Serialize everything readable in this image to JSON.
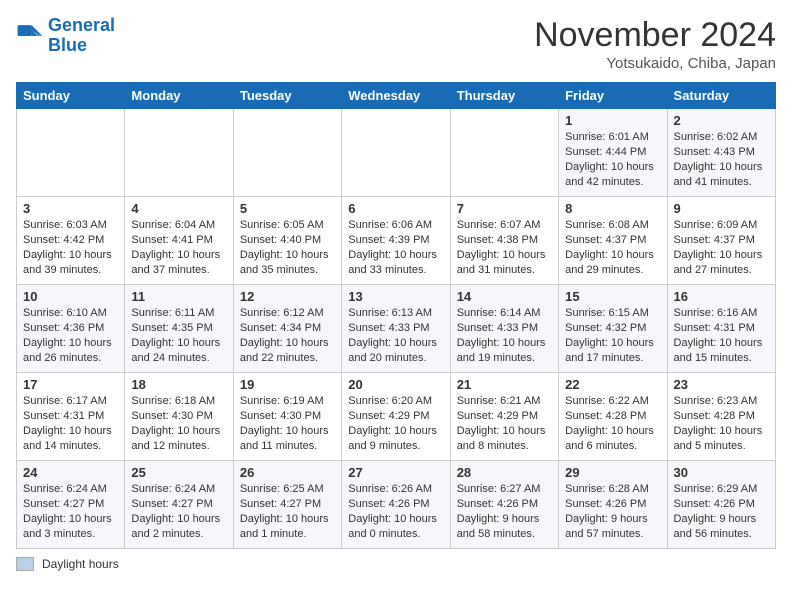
{
  "header": {
    "logo_line1": "General",
    "logo_line2": "Blue",
    "month": "November 2024",
    "location": "Yotsukaido, Chiba, Japan"
  },
  "weekdays": [
    "Sunday",
    "Monday",
    "Tuesday",
    "Wednesday",
    "Thursday",
    "Friday",
    "Saturday"
  ],
  "weeks": [
    [
      {
        "day": "",
        "info": ""
      },
      {
        "day": "",
        "info": ""
      },
      {
        "day": "",
        "info": ""
      },
      {
        "day": "",
        "info": ""
      },
      {
        "day": "",
        "info": ""
      },
      {
        "day": "1",
        "info": "Sunrise: 6:01 AM\nSunset: 4:44 PM\nDaylight: 10 hours and 42 minutes."
      },
      {
        "day": "2",
        "info": "Sunrise: 6:02 AM\nSunset: 4:43 PM\nDaylight: 10 hours and 41 minutes."
      }
    ],
    [
      {
        "day": "3",
        "info": "Sunrise: 6:03 AM\nSunset: 4:42 PM\nDaylight: 10 hours and 39 minutes."
      },
      {
        "day": "4",
        "info": "Sunrise: 6:04 AM\nSunset: 4:41 PM\nDaylight: 10 hours and 37 minutes."
      },
      {
        "day": "5",
        "info": "Sunrise: 6:05 AM\nSunset: 4:40 PM\nDaylight: 10 hours and 35 minutes."
      },
      {
        "day": "6",
        "info": "Sunrise: 6:06 AM\nSunset: 4:39 PM\nDaylight: 10 hours and 33 minutes."
      },
      {
        "day": "7",
        "info": "Sunrise: 6:07 AM\nSunset: 4:38 PM\nDaylight: 10 hours and 31 minutes."
      },
      {
        "day": "8",
        "info": "Sunrise: 6:08 AM\nSunset: 4:37 PM\nDaylight: 10 hours and 29 minutes."
      },
      {
        "day": "9",
        "info": "Sunrise: 6:09 AM\nSunset: 4:37 PM\nDaylight: 10 hours and 27 minutes."
      }
    ],
    [
      {
        "day": "10",
        "info": "Sunrise: 6:10 AM\nSunset: 4:36 PM\nDaylight: 10 hours and 26 minutes."
      },
      {
        "day": "11",
        "info": "Sunrise: 6:11 AM\nSunset: 4:35 PM\nDaylight: 10 hours and 24 minutes."
      },
      {
        "day": "12",
        "info": "Sunrise: 6:12 AM\nSunset: 4:34 PM\nDaylight: 10 hours and 22 minutes."
      },
      {
        "day": "13",
        "info": "Sunrise: 6:13 AM\nSunset: 4:33 PM\nDaylight: 10 hours and 20 minutes."
      },
      {
        "day": "14",
        "info": "Sunrise: 6:14 AM\nSunset: 4:33 PM\nDaylight: 10 hours and 19 minutes."
      },
      {
        "day": "15",
        "info": "Sunrise: 6:15 AM\nSunset: 4:32 PM\nDaylight: 10 hours and 17 minutes."
      },
      {
        "day": "16",
        "info": "Sunrise: 6:16 AM\nSunset: 4:31 PM\nDaylight: 10 hours and 15 minutes."
      }
    ],
    [
      {
        "day": "17",
        "info": "Sunrise: 6:17 AM\nSunset: 4:31 PM\nDaylight: 10 hours and 14 minutes."
      },
      {
        "day": "18",
        "info": "Sunrise: 6:18 AM\nSunset: 4:30 PM\nDaylight: 10 hours and 12 minutes."
      },
      {
        "day": "19",
        "info": "Sunrise: 6:19 AM\nSunset: 4:30 PM\nDaylight: 10 hours and 11 minutes."
      },
      {
        "day": "20",
        "info": "Sunrise: 6:20 AM\nSunset: 4:29 PM\nDaylight: 10 hours and 9 minutes."
      },
      {
        "day": "21",
        "info": "Sunrise: 6:21 AM\nSunset: 4:29 PM\nDaylight: 10 hours and 8 minutes."
      },
      {
        "day": "22",
        "info": "Sunrise: 6:22 AM\nSunset: 4:28 PM\nDaylight: 10 hours and 6 minutes."
      },
      {
        "day": "23",
        "info": "Sunrise: 6:23 AM\nSunset: 4:28 PM\nDaylight: 10 hours and 5 minutes."
      }
    ],
    [
      {
        "day": "24",
        "info": "Sunrise: 6:24 AM\nSunset: 4:27 PM\nDaylight: 10 hours and 3 minutes."
      },
      {
        "day": "25",
        "info": "Sunrise: 6:24 AM\nSunset: 4:27 PM\nDaylight: 10 hours and 2 minutes."
      },
      {
        "day": "26",
        "info": "Sunrise: 6:25 AM\nSunset: 4:27 PM\nDaylight: 10 hours and 1 minute."
      },
      {
        "day": "27",
        "info": "Sunrise: 6:26 AM\nSunset: 4:26 PM\nDaylight: 10 hours and 0 minutes."
      },
      {
        "day": "28",
        "info": "Sunrise: 6:27 AM\nSunset: 4:26 PM\nDaylight: 9 hours and 58 minutes."
      },
      {
        "day": "29",
        "info": "Sunrise: 6:28 AM\nSunset: 4:26 PM\nDaylight: 9 hours and 57 minutes."
      },
      {
        "day": "30",
        "info": "Sunrise: 6:29 AM\nSunset: 4:26 PM\nDaylight: 9 hours and 56 minutes."
      }
    ]
  ],
  "legend": {
    "daylight_label": "Daylight hours"
  }
}
